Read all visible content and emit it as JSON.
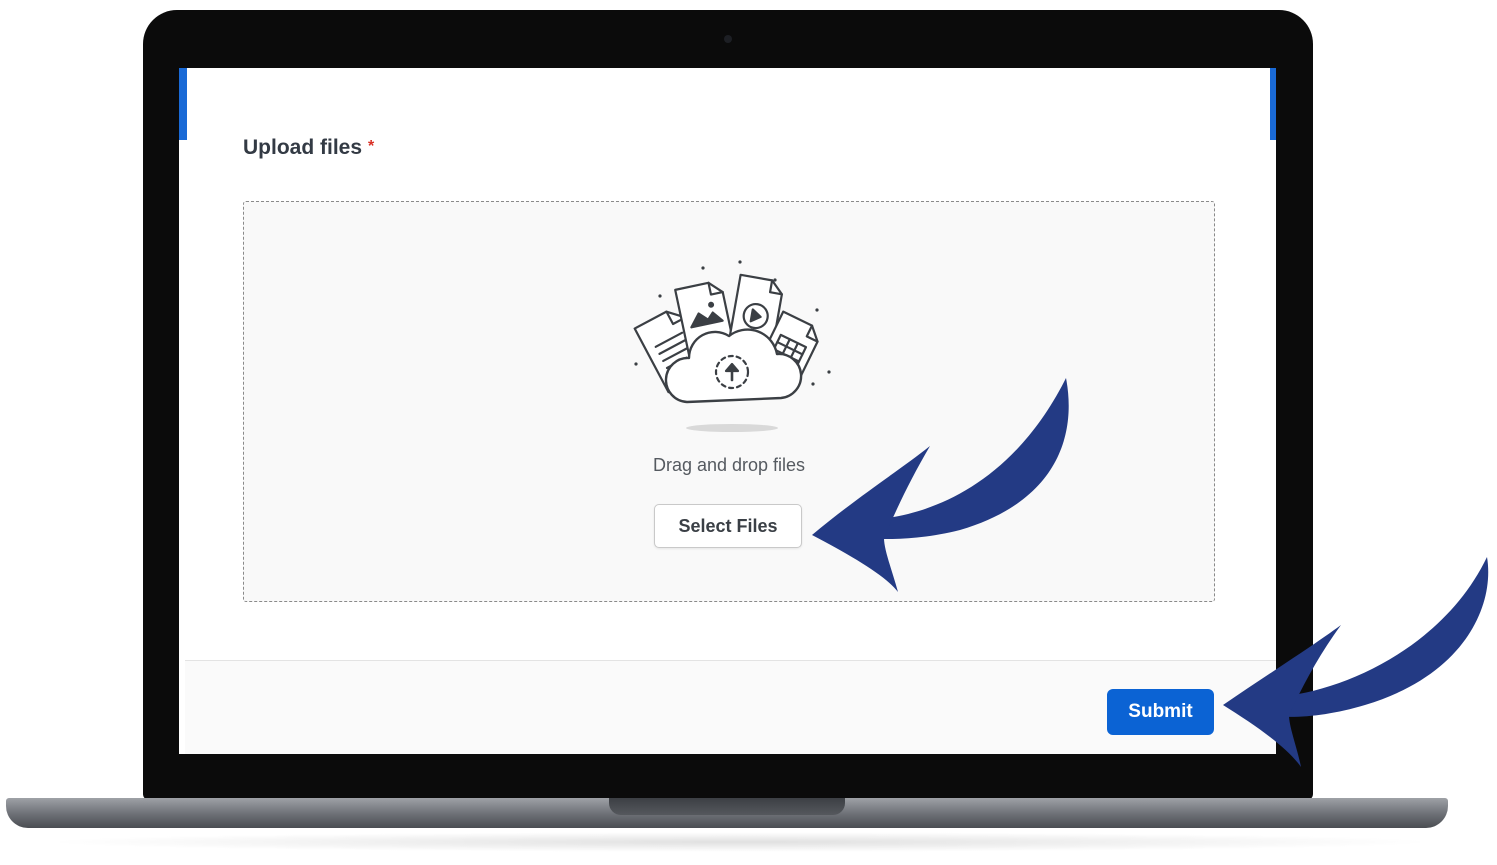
{
  "form": {
    "upload_label": "Upload files",
    "required_marker": "*",
    "dropzone": {
      "illustration": "cloud-upload-files-icon",
      "instruction": "Drag and drop files",
      "select_button_label": "Select Files"
    },
    "submit_label": "Submit"
  },
  "annotations": [
    {
      "name": "arrow-to-select-files",
      "color": "#233a84"
    },
    {
      "name": "arrow-to-submit",
      "color": "#233a84"
    }
  ],
  "colors": {
    "accent": "#1a6ad6",
    "submit_button": "#0b63d4",
    "required": "#d93025",
    "annotation_arrow": "#233a84"
  }
}
